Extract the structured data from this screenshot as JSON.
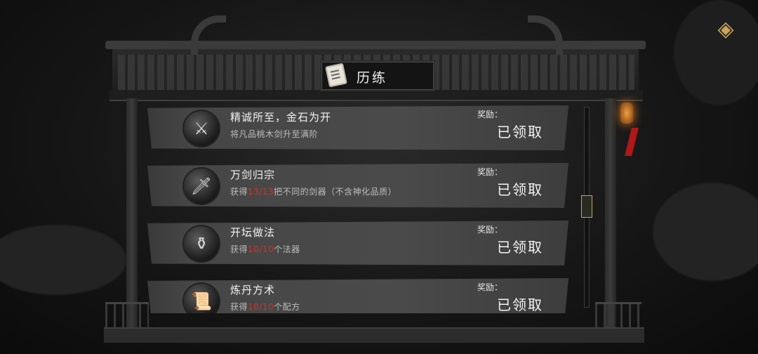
{
  "header": {
    "title": "历练"
  },
  "achievements": [
    {
      "title": "精诚所至，金石为开",
      "desc_pre": "将凡品桃木剑升至满阶",
      "desc_hl": "",
      "desc_post": "",
      "reward_label": "奖励：",
      "status": "已领取",
      "icon": "sword-icon",
      "glyph": "⚔"
    },
    {
      "title": "万剑归宗",
      "desc_pre": "获得",
      "desc_hl": "13/13",
      "desc_post": "把不同的剑器（不含神化品质）",
      "reward_label": "奖励：",
      "status": "已领取",
      "icon": "swords-bundle-icon",
      "glyph": "🗡"
    },
    {
      "title": "开坛做法",
      "desc_pre": "获得",
      "desc_hl": "10/10",
      "desc_post": "个法器",
      "reward_label": "奖励：",
      "status": "已领取",
      "icon": "treasure-chest-icon",
      "glyph": "⚱"
    },
    {
      "title": "炼丹方术",
      "desc_pre": "获得",
      "desc_hl": "10/10",
      "desc_post": "个配方",
      "reward_label": "奖励：",
      "status": "已领取",
      "icon": "recipe-book-icon",
      "glyph": "📜"
    }
  ],
  "corner": {
    "icon": "return-icon",
    "glyph": "◈"
  },
  "colors": {
    "highlight": "#d2322d",
    "thumb_border": "#b9a770"
  }
}
